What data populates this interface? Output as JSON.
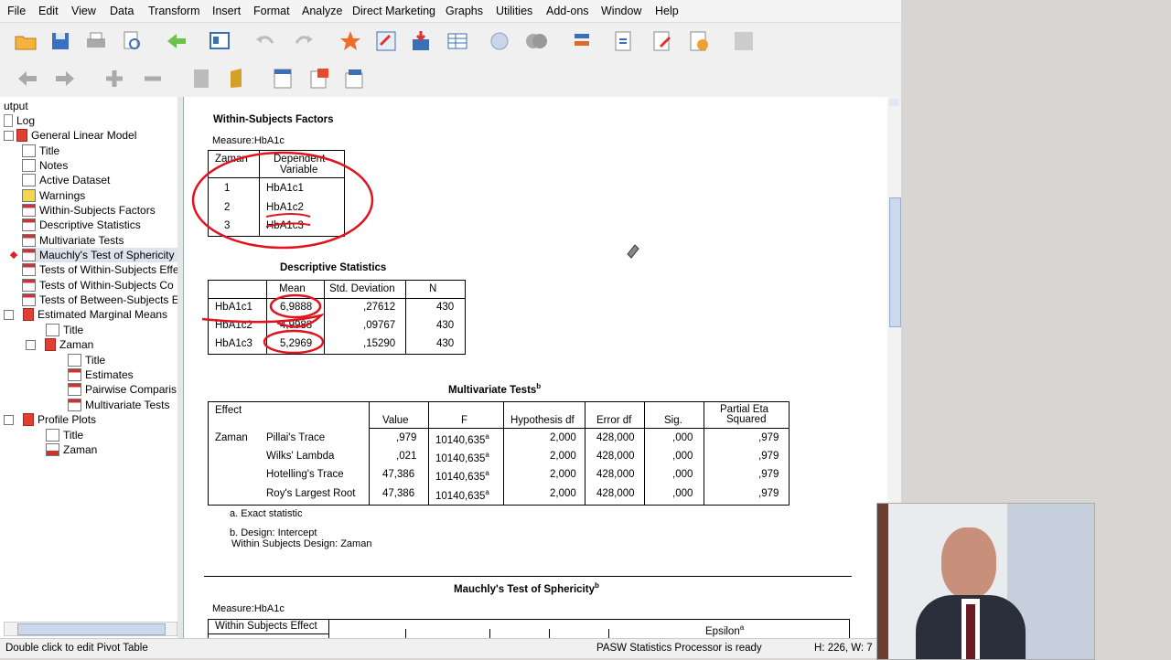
{
  "menu": [
    "File",
    "Edit",
    "View",
    "Data",
    "Transform",
    "Insert",
    "Format",
    "Analyze",
    "Direct Marketing",
    "Graphs",
    "Utilities",
    "Add-ons",
    "Window",
    "Help"
  ],
  "tree": {
    "root": "utput",
    "log": "Log",
    "glm": "General Linear Model",
    "items": [
      "Title",
      "Notes",
      "Active Dataset",
      "Warnings",
      "Within-Subjects Factors",
      "Descriptive Statistics",
      "Multivariate Tests",
      "Mauchly's Test of Sphericity",
      "Tests of Within-Subjects Effe",
      "Tests of Within-Subjects Co",
      "Tests of Between-Subjects E"
    ],
    "emm": "Estimated Marginal Means",
    "emm_title": "Title",
    "zaman": "Zaman",
    "zaman_items": [
      "Title",
      "Estimates",
      "Pairwise Comparis",
      "Multivariate Tests"
    ],
    "profile": "Profile Plots",
    "profile_items": [
      "Title",
      "Zaman"
    ]
  },
  "wsf": {
    "title": "Within-Subjects Factors",
    "measure": "Measure:HbA1c",
    "col1": "Zaman",
    "col2a": "Dependent",
    "col2b": "Variable",
    "rows": [
      [
        "1",
        "HbA1c1"
      ],
      [
        "2",
        "HbA1c2"
      ],
      [
        "3",
        "HbA1c3"
      ]
    ]
  },
  "desc": {
    "title": "Descriptive Statistics",
    "headers": [
      "Mean",
      "Std. Deviation",
      "N"
    ],
    "rows": [
      [
        "HbA1c1",
        "6,9888",
        ",27612",
        "430"
      ],
      [
        "HbA1c2",
        "4,9988",
        ",09767",
        "430"
      ],
      [
        "HbA1c3",
        "5,2969",
        ",15290",
        "430"
      ]
    ]
  },
  "multi": {
    "title": "Multivariate Tests",
    "title_sup": "b",
    "headers": [
      "Effect",
      "Value",
      "F",
      "Hypothesis df",
      "Error df",
      "Sig.",
      "Partial Eta",
      "Squared"
    ],
    "effect": "Zaman",
    "rows": [
      [
        "Pillai's Trace",
        ",979",
        "10140,635",
        "2,000",
        "428,000",
        ",000",
        ",979"
      ],
      [
        "Wilks' Lambda",
        ",021",
        "10140,635",
        "2,000",
        "428,000",
        ",000",
        ",979"
      ],
      [
        "Hotelling's Trace",
        "47,386",
        "10140,635",
        "2,000",
        "428,000",
        ",000",
        ",979"
      ],
      [
        "Roy's Largest Root",
        "47,386",
        "10140,635",
        "2,000",
        "428,000",
        ",000",
        ",979"
      ]
    ],
    "f_sup": "a",
    "note_a": "a. Exact statistic",
    "note_b1": "b. Design: Intercept",
    "note_b2": "Within Subjects Design: Zaman"
  },
  "mauchly": {
    "title": "Mauchly's Test of Sphericity",
    "title_sup": "b",
    "measure": "Measure:HbA1c",
    "col1": "Within Subjects Effect",
    "epsilon": "Epsilon",
    "epsilon_sup": "a"
  },
  "status": {
    "left": "Double click to edit Pivot Table",
    "mid": "PASW Statistics Processor is ready",
    "right": "H: 226, W: 7"
  },
  "colors": {
    "annotation": "#e0141e",
    "toolbar_bg": "#f0f0f0",
    "tree_selected": "#dde4ee"
  }
}
